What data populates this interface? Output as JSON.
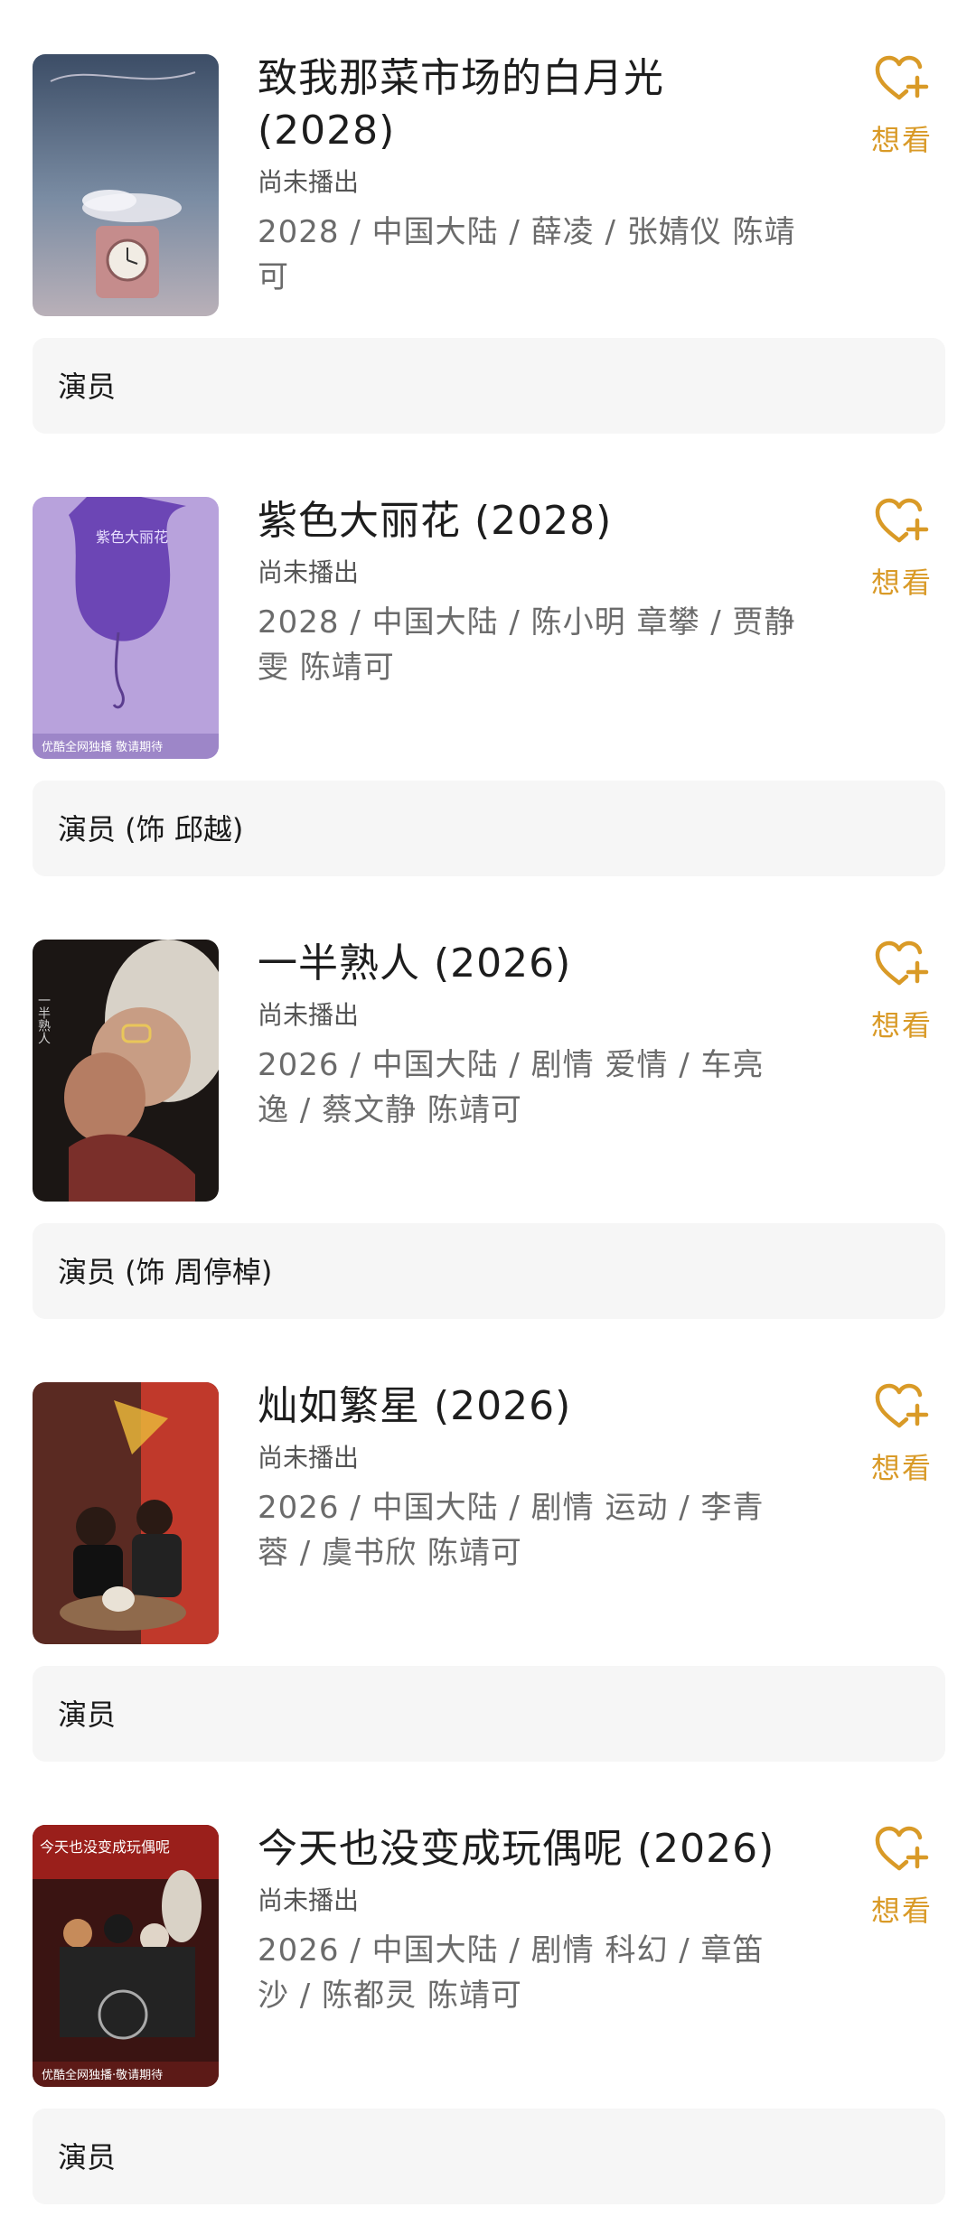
{
  "want_label": "想看",
  "colors": {
    "accent": "#d99a27",
    "role_bg": "#f6f6f6"
  },
  "items": [
    {
      "title_line1": "致我那菜市场的白月光",
      "title_line2": "(2028)",
      "status": "尚未播出",
      "meta_line1": "2028 / 中国大陆 / 薛凌 / 张婧仪 陈靖",
      "meta_line2": "可",
      "role": "演员",
      "poster_icon": "moon-clock-poster"
    },
    {
      "title_line1": "紫色大丽花 (2028)",
      "title_line2": "",
      "status": "尚未播出",
      "meta_line1": "2028 / 中国大陆 / 陈小明 章攀 / 贾静",
      "meta_line2": "雯 陈靖可",
      "role": "演员 (饰 邱越)",
      "poster_icon": "purple-dahlia-poster",
      "poster_caption": "优酷全网独播 敬请期待"
    },
    {
      "title_line1": "一半熟人 (2026)",
      "title_line2": "",
      "status": "尚未播出",
      "meta_line1": "2026 / 中国大陆 / 剧情 爱情 / 车亮",
      "meta_line2": "逸 / 蔡文静 陈靖可",
      "role": "演员 (饰 周停棹)",
      "poster_icon": "couple-poster"
    },
    {
      "title_line1": "灿如繁星 (2026)",
      "title_line2": "",
      "status": "尚未播出",
      "meta_line1": "2026 / 中国大陆 / 剧情 运动 / 李青",
      "meta_line2": "蓉 / 虞书欣 陈靖可",
      "role": "演员",
      "poster_icon": "stars-poster"
    },
    {
      "title_line1": "今天也没变成玩偶呢 (2026)",
      "title_line2": "",
      "status": "尚未播出",
      "meta_line1": "2026 / 中国大陆 / 剧情 科幻 / 章笛",
      "meta_line2": "沙 / 陈都灵 陈靖可",
      "role": "演员",
      "poster_icon": "doll-poster",
      "poster_caption": "优酷全网独播·敬请期待"
    }
  ]
}
